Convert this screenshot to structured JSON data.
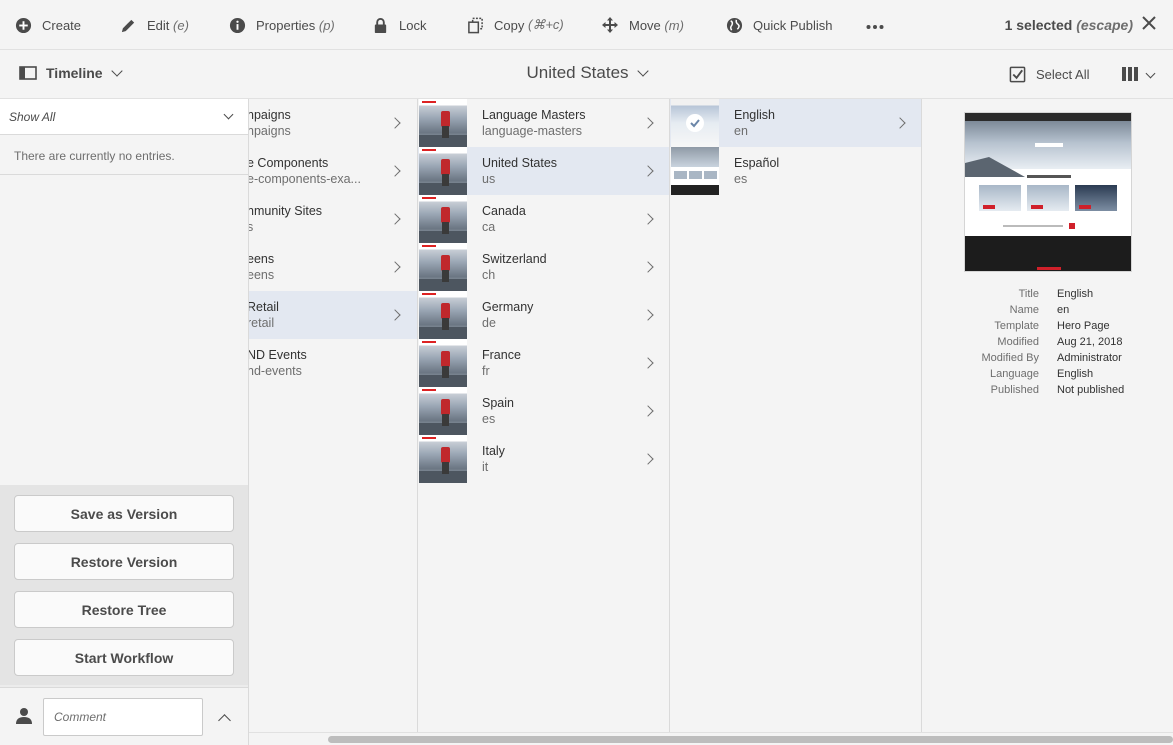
{
  "actionbar": {
    "items": [
      {
        "label": "Create",
        "shortcut": "",
        "icon": "plus-circle-icon"
      },
      {
        "label": "Edit",
        "shortcut": "(e)",
        "icon": "pencil-icon"
      },
      {
        "label": "Properties",
        "shortcut": "(p)",
        "icon": "info-icon"
      },
      {
        "label": "Lock",
        "shortcut": "",
        "icon": "lock-icon"
      },
      {
        "label": "Copy",
        "shortcut": "(⌘+c)",
        "icon": "copy-icon"
      },
      {
        "label": "Move",
        "shortcut": "(m)",
        "icon": "move-icon"
      },
      {
        "label": "Quick Publish",
        "shortcut": "",
        "icon": "globe-icon"
      }
    ],
    "more_icon": "more-icon",
    "selection": {
      "count_text": "1 selected",
      "escape_text": "(escape)"
    }
  },
  "subbar": {
    "rail_label": "Timeline",
    "title": "United States",
    "select_all": "Select All"
  },
  "rail": {
    "filter": "Show All",
    "empty": "There are currently no entries.",
    "buttons": [
      "Save as Version",
      "Restore Version",
      "Restore Tree",
      "Start Workflow"
    ],
    "comment_placeholder": "Comment"
  },
  "columns": {
    "col1": [
      {
        "title": "npaigns",
        "name": "npaigns"
      },
      {
        "title": "e Components",
        "name": "e-components-exa..."
      },
      {
        "title": "nmunity Sites",
        "name": "s"
      },
      {
        "title": "eens",
        "name": "eens"
      },
      {
        "title": "Retail",
        "name": "retail"
      },
      {
        "title": "ND Events",
        "name": "nd-events"
      }
    ],
    "col2": [
      {
        "title": "Language Masters",
        "name": "language-masters"
      },
      {
        "title": "United States",
        "name": "us"
      },
      {
        "title": "Canada",
        "name": "ca"
      },
      {
        "title": "Switzerland",
        "name": "ch"
      },
      {
        "title": "Germany",
        "name": "de"
      },
      {
        "title": "France",
        "name": "fr"
      },
      {
        "title": "Spain",
        "name": "es"
      },
      {
        "title": "Italy",
        "name": "it"
      }
    ],
    "col3": [
      {
        "title": "English",
        "name": "en"
      },
      {
        "title": "Español",
        "name": "es"
      }
    ]
  },
  "details": {
    "properties": [
      {
        "key": "Title",
        "value": "English"
      },
      {
        "key": "Name",
        "value": "en"
      },
      {
        "key": "Template",
        "value": "Hero Page"
      },
      {
        "key": "Modified",
        "value": "Aug 21, 2018"
      },
      {
        "key": "Modified By",
        "value": "Administrator"
      },
      {
        "key": "Language",
        "value": "English"
      },
      {
        "key": "Published",
        "value": "Not published"
      }
    ]
  },
  "colors": {
    "selection_bg": "#e3e8f1",
    "accent_red": "#d0202a",
    "text": "#4b4b4b"
  }
}
